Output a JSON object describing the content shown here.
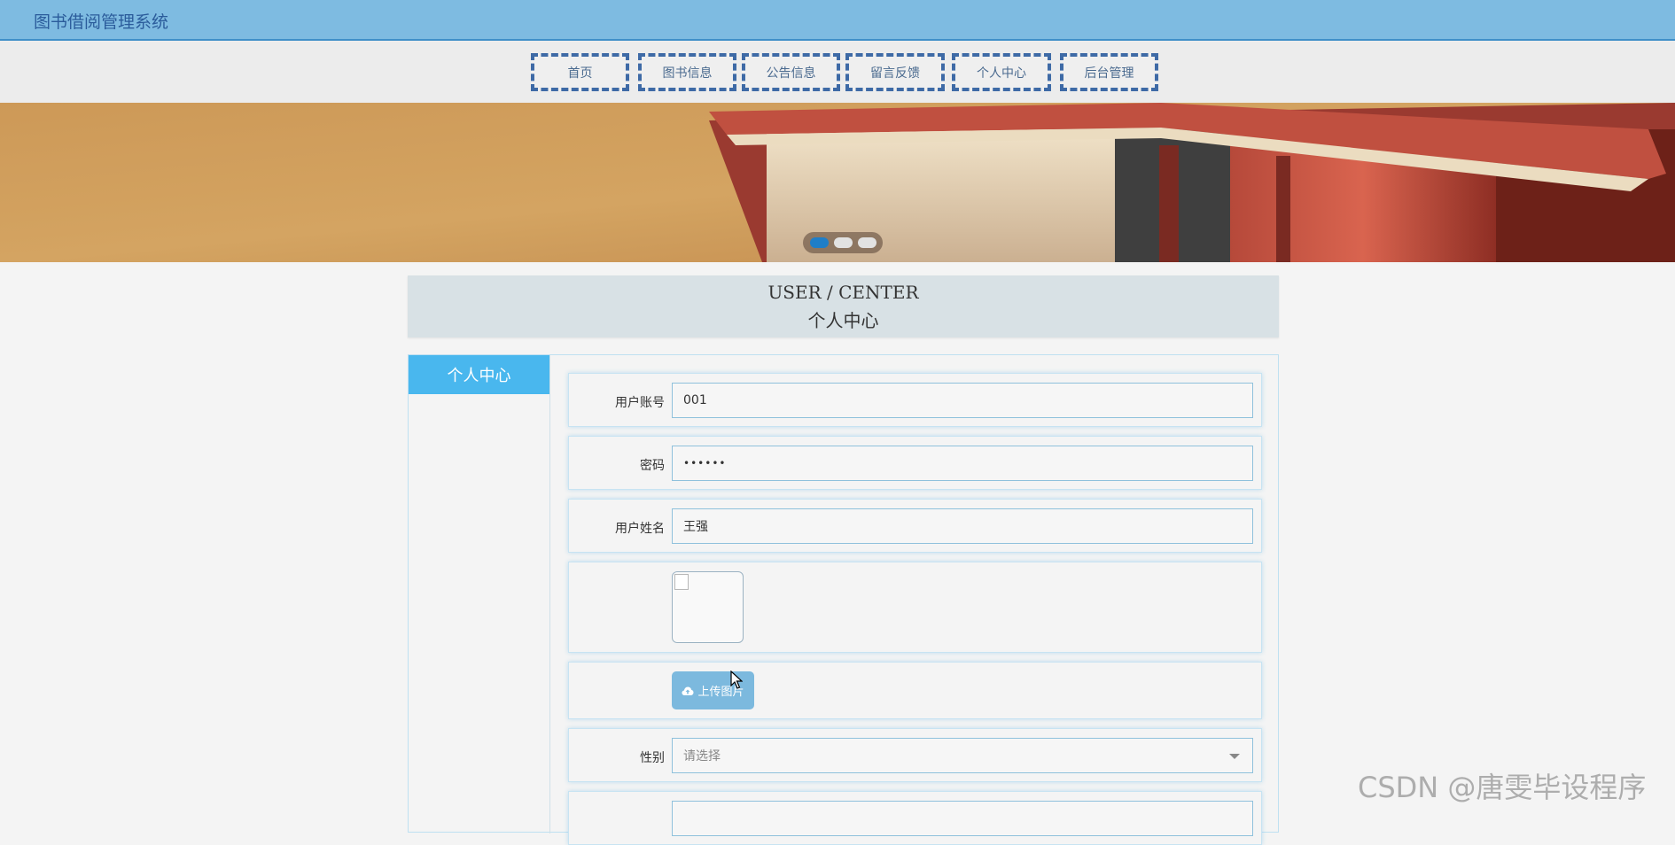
{
  "app": {
    "title": "图书借阅管理系统"
  },
  "nav": [
    {
      "label": "首页"
    },
    {
      "label": "图书信息"
    },
    {
      "label": "公告信息"
    },
    {
      "label": "留言反馈"
    },
    {
      "label": "个人中心"
    },
    {
      "label": "后台管理"
    }
  ],
  "banner": {
    "slides": 3,
    "active_slide": 1
  },
  "section": {
    "title_en": "USER / CENTER",
    "title_zh": "个人中心"
  },
  "sidebar": {
    "items": [
      {
        "label": "个人中心"
      }
    ]
  },
  "form": {
    "account": {
      "label": "用户账号",
      "value": "001"
    },
    "password": {
      "label": "密码",
      "value": "••••••"
    },
    "name": {
      "label": "用户姓名",
      "value": "王强"
    },
    "upload": {
      "label": "上传图片",
      "icon": "cloud-upload-icon"
    },
    "gender": {
      "label": "性别",
      "placeholder": "请选择"
    }
  },
  "watermark": "CSDN @唐雯毕设程序",
  "colors": {
    "topbar": "#7ebbe1",
    "accent": "#49b7ee",
    "nav_border": "#3e6aa6"
  }
}
